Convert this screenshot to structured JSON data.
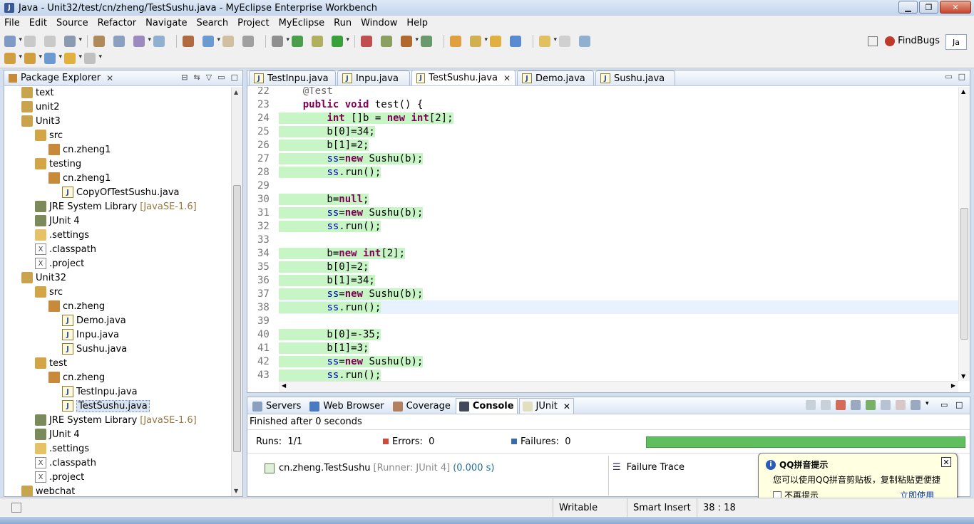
{
  "window": {
    "title": "Java - Unit32/test/cn/zheng/TestSushu.java - MyEclipse Enterprise Workbench"
  },
  "menu": [
    "File",
    "Edit",
    "Source",
    "Refactor",
    "Navigate",
    "Search",
    "Project",
    "MyEclipse",
    "Run",
    "Window",
    "Help"
  ],
  "toolbar": {
    "findbugs_label": "FindBugs",
    "perspective_label": "Ja"
  },
  "package_explorer": {
    "title": "Package Explorer",
    "items": [
      {
        "label": "text",
        "icon": "project-icon",
        "level": 1
      },
      {
        "label": "unit2",
        "icon": "project-icon",
        "level": 1
      },
      {
        "label": "Unit3",
        "icon": "project-icon",
        "level": 1
      },
      {
        "label": "src",
        "icon": "source-folder-icon",
        "level": 2
      },
      {
        "label": "cn.zheng1",
        "icon": "package-icon",
        "level": 3
      },
      {
        "label": "testing",
        "icon": "source-folder-icon",
        "level": 2
      },
      {
        "label": "cn.zheng1",
        "icon": "package-icon",
        "level": 3
      },
      {
        "label": "CopyOfTestSushu.java",
        "icon": "java-file-icon",
        "level": 4
      },
      {
        "label": "JRE System Library",
        "annotation": "[JavaSE-1.6]",
        "icon": "library-icon",
        "level": 2
      },
      {
        "label": "JUnit 4",
        "icon": "library-icon",
        "level": 2
      },
      {
        "label": ".settings",
        "icon": "folder-icon",
        "level": 2
      },
      {
        "label": ".classpath",
        "icon": "xml-file-icon",
        "level": 2
      },
      {
        "label": ".project",
        "icon": "xml-file-icon",
        "level": 2
      },
      {
        "label": "Unit32",
        "icon": "project-icon",
        "level": 1
      },
      {
        "label": "src",
        "icon": "source-folder-icon",
        "level": 2
      },
      {
        "label": "cn.zheng",
        "icon": "package-icon",
        "level": 3
      },
      {
        "label": "Demo.java",
        "icon": "java-file-icon",
        "level": 4
      },
      {
        "label": "Inpu.java",
        "icon": "java-file-icon",
        "level": 4
      },
      {
        "label": "Sushu.java",
        "icon": "java-file-icon",
        "level": 4
      },
      {
        "label": "test",
        "icon": "source-folder-icon",
        "level": 2
      },
      {
        "label": "cn.zheng",
        "icon": "package-icon",
        "level": 3
      },
      {
        "label": "TestInpu.java",
        "icon": "java-file-icon",
        "level": 4
      },
      {
        "label": "TestSushu.java",
        "icon": "java-file-icon",
        "level": 4,
        "selected": true
      },
      {
        "label": "JRE System Library",
        "annotation": "[JavaSE-1.6]",
        "icon": "library-icon",
        "level": 2
      },
      {
        "label": "JUnit 4",
        "icon": "library-icon",
        "level": 2
      },
      {
        "label": ".settings",
        "icon": "folder-icon",
        "level": 2
      },
      {
        "label": ".classpath",
        "icon": "xml-file-icon",
        "level": 2
      },
      {
        "label": ".project",
        "icon": "xml-file-icon",
        "level": 2
      },
      {
        "label": "webchat",
        "icon": "project-icon",
        "level": 1
      }
    ]
  },
  "editor": {
    "tabs": [
      {
        "label": "TestInpu.java",
        "active": false
      },
      {
        "label": "Inpu.java",
        "active": false
      },
      {
        "label": "TestSushu.java",
        "active": true
      },
      {
        "label": "Demo.java",
        "active": false
      },
      {
        "label": "Sushu.java",
        "active": false
      }
    ],
    "lines": [
      {
        "n": "22",
        "code": "    @Test",
        "hl": false
      },
      {
        "n": "23",
        "code": "    public void test() {",
        "hl": false
      },
      {
        "n": "24",
        "code": "        int []b = new int[2];",
        "hl": true
      },
      {
        "n": "25",
        "code": "        b[0]=34;",
        "hl": true
      },
      {
        "n": "26",
        "code": "        b[1]=2;",
        "hl": true
      },
      {
        "n": "27",
        "code": "        ss=new Sushu(b);",
        "hl": true
      },
      {
        "n": "28",
        "code": "        ss.run();",
        "hl": true
      },
      {
        "n": "29",
        "code": "",
        "hl": false
      },
      {
        "n": "30",
        "code": "        b=null;",
        "hl": true
      },
      {
        "n": "31",
        "code": "        ss=new Sushu(b);",
        "hl": true
      },
      {
        "n": "32",
        "code": "        ss.run();",
        "hl": true
      },
      {
        "n": "33",
        "code": "",
        "hl": false
      },
      {
        "n": "34",
        "code": "        b=new int[2];",
        "hl": true
      },
      {
        "n": "35",
        "code": "        b[0]=2;",
        "hl": true
      },
      {
        "n": "36",
        "code": "        b[1]=34;",
        "hl": true
      },
      {
        "n": "37",
        "code": "        ss=new Sushu(b);",
        "hl": true
      },
      {
        "n": "38",
        "code": "        ss.run();",
        "hl": true,
        "current": true
      },
      {
        "n": "39",
        "code": "",
        "hl": false
      },
      {
        "n": "40",
        "code": "        b[0]=-35;",
        "hl": true
      },
      {
        "n": "41",
        "code": "        b[1]=3;",
        "hl": true
      },
      {
        "n": "42",
        "code": "        ss=new Sushu(b);",
        "hl": true
      },
      {
        "n": "43",
        "code": "        ss.run();",
        "hl": true
      }
    ],
    "highlight_color": "#c7f5c5"
  },
  "bottom_panel": {
    "tabs": [
      {
        "label": "Servers",
        "icon": "servers-icon"
      },
      {
        "label": "Web Browser",
        "icon": "globe-icon"
      },
      {
        "label": "Coverage",
        "icon": "coverage-icon"
      },
      {
        "label": "Console",
        "icon": "console-icon",
        "active": true
      },
      {
        "label": "JUnit",
        "icon": "junit-icon"
      }
    ],
    "junit": {
      "finished": "Finished after 0 seconds",
      "runs_label": "Runs:",
      "runs_value": "1/1",
      "errors_label": "Errors:",
      "errors_value": "0",
      "failures_label": "Failures:",
      "failures_value": "0",
      "progress": 1.0,
      "progress_color": "#5fbf5f",
      "result_name": "cn.zheng.TestSushu",
      "result_runner": "[Runner: JUnit 4]",
      "result_time": "(0.000 s)",
      "failure_trace": "Failure Trace"
    }
  },
  "status_bar": {
    "writable": "Writable",
    "insert_mode": "Smart Insert",
    "position": "38 : 18"
  },
  "qq_popup": {
    "title": "QQ拼音提示",
    "message": "您可以使用QQ拼音剪贴板，复制粘贴更便捷",
    "checkbox_label": "不再提示",
    "link_label": "立即使用"
  }
}
